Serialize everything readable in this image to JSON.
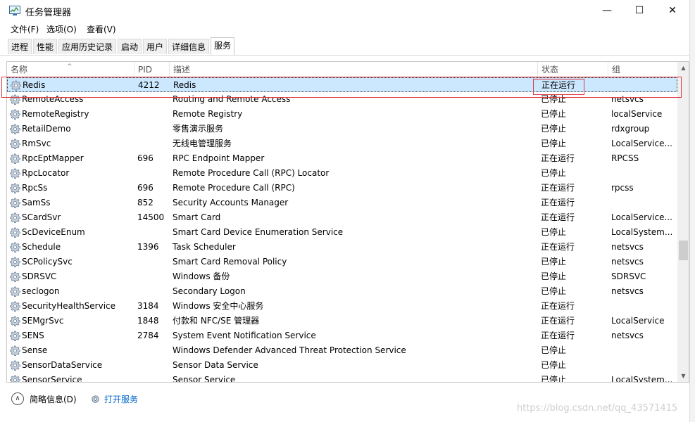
{
  "window": {
    "title": "任务管理器",
    "minimize": "—",
    "maximize": "☐",
    "close": "✕"
  },
  "menu": [
    "文件(F)",
    "选项(O)",
    "查看(V)"
  ],
  "tabs": [
    "进程",
    "性能",
    "应用历史记录",
    "启动",
    "用户",
    "详细信息",
    "服务"
  ],
  "active_tab": "服务",
  "columns": {
    "name": "名称",
    "pid": "PID",
    "desc": "描述",
    "status": "状态",
    "group": "组"
  },
  "rows": [
    {
      "name": "Redis",
      "pid": "4212",
      "desc": "Redis",
      "status": "正在运行",
      "group": ""
    },
    {
      "name": "RemoteAccess",
      "pid": "",
      "desc": "Routing and Remote Access",
      "status": "已停止",
      "group": "netsvcs"
    },
    {
      "name": "RemoteRegistry",
      "pid": "",
      "desc": "Remote Registry",
      "status": "已停止",
      "group": "localService"
    },
    {
      "name": "RetailDemo",
      "pid": "",
      "desc": "零售演示服务",
      "status": "已停止",
      "group": "rdxgroup"
    },
    {
      "name": "RmSvc",
      "pid": "",
      "desc": "无线电管理服务",
      "status": "已停止",
      "group": "LocalService..."
    },
    {
      "name": "RpcEptMapper",
      "pid": "696",
      "desc": "RPC Endpoint Mapper",
      "status": "正在运行",
      "group": "RPCSS"
    },
    {
      "name": "RpcLocator",
      "pid": "",
      "desc": "Remote Procedure Call (RPC) Locator",
      "status": "已停止",
      "group": ""
    },
    {
      "name": "RpcSs",
      "pid": "696",
      "desc": "Remote Procedure Call (RPC)",
      "status": "正在运行",
      "group": "rpcss"
    },
    {
      "name": "SamSs",
      "pid": "852",
      "desc": "Security Accounts Manager",
      "status": "正在运行",
      "group": ""
    },
    {
      "name": "SCardSvr",
      "pid": "14500",
      "desc": "Smart Card",
      "status": "正在运行",
      "group": "LocalService..."
    },
    {
      "name": "ScDeviceEnum",
      "pid": "",
      "desc": "Smart Card Device Enumeration Service",
      "status": "已停止",
      "group": "LocalSystem..."
    },
    {
      "name": "Schedule",
      "pid": "1396",
      "desc": "Task Scheduler",
      "status": "正在运行",
      "group": "netsvcs"
    },
    {
      "name": "SCPolicySvc",
      "pid": "",
      "desc": "Smart Card Removal Policy",
      "status": "已停止",
      "group": "netsvcs"
    },
    {
      "name": "SDRSVC",
      "pid": "",
      "desc": "Windows 备份",
      "status": "已停止",
      "group": "SDRSVC"
    },
    {
      "name": "seclogon",
      "pid": "",
      "desc": "Secondary Logon",
      "status": "已停止",
      "group": "netsvcs"
    },
    {
      "name": "SecurityHealthService",
      "pid": "3184",
      "desc": "Windows 安全中心服务",
      "status": "正在运行",
      "group": ""
    },
    {
      "name": "SEMgrSvc",
      "pid": "1848",
      "desc": "付款和 NFC/SE 管理器",
      "status": "正在运行",
      "group": "LocalService"
    },
    {
      "name": "SENS",
      "pid": "2784",
      "desc": "System Event Notification Service",
      "status": "正在运行",
      "group": "netsvcs"
    },
    {
      "name": "Sense",
      "pid": "",
      "desc": "Windows Defender Advanced Threat Protection Service",
      "status": "已停止",
      "group": ""
    },
    {
      "name": "SensorDataService",
      "pid": "",
      "desc": "Sensor Data Service",
      "status": "已停止",
      "group": ""
    },
    {
      "name": "SensorService",
      "pid": "",
      "desc": "Sensor Service",
      "status": "已停止",
      "group": "LocalSystem..."
    }
  ],
  "footer": {
    "fewer_details": "简略信息(D)",
    "open_services": "打开服务"
  },
  "watermark": "https://blog.csdn.net/qq_43571415",
  "colors": {
    "selected_row": "#cce8ff",
    "highlight_box": "#e0373c",
    "link": "#0066cc"
  }
}
